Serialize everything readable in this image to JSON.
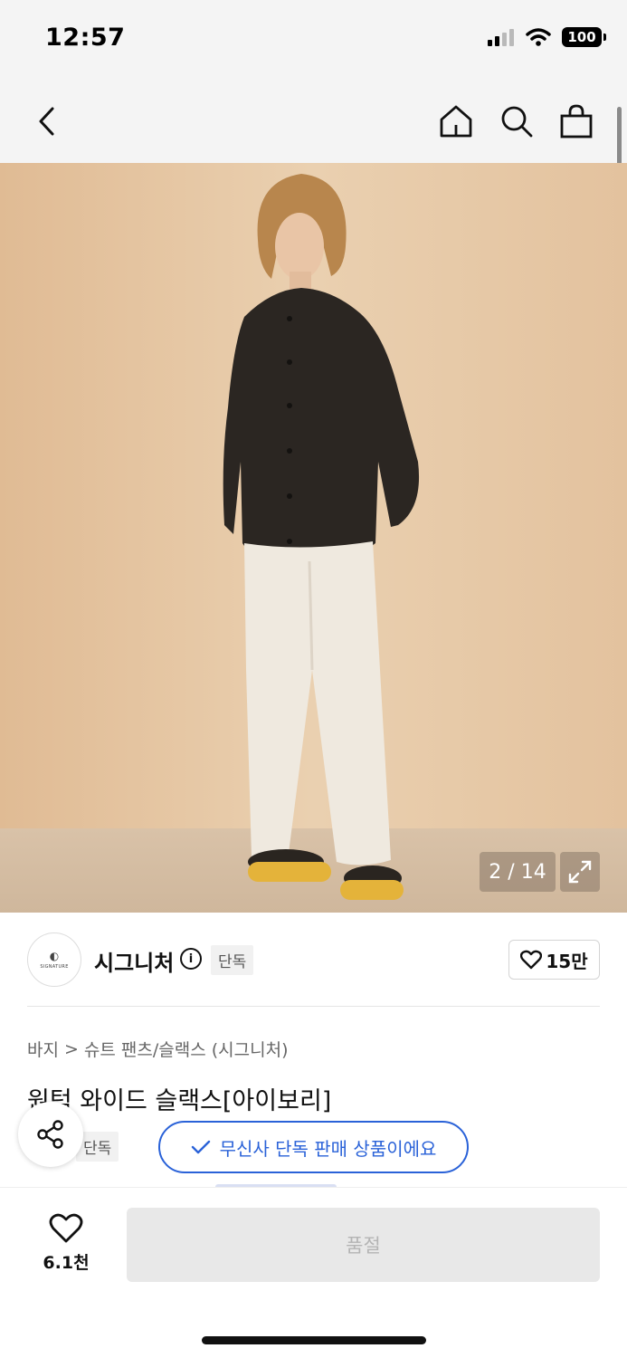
{
  "status_bar": {
    "time": "12:57",
    "battery": "100"
  },
  "nav": {
    "back_icon": "chevron-left-icon",
    "home_icon": "home-icon",
    "search_icon": "search-icon",
    "cart_icon": "shopping-bag-icon"
  },
  "gallery": {
    "counter": "2 / 14",
    "current": 2,
    "total": 14,
    "expand_icon": "expand-icon"
  },
  "brand": {
    "logo_text": "SIGNATURE",
    "name": "시그니처",
    "tag": "단독",
    "like_count": "15만"
  },
  "breadcrumb": {
    "category": "바지",
    "separator": ">",
    "subcategory": "슈트 팬츠/슬랙스 (시그니처)"
  },
  "product": {
    "title": "원턱 와이드 슬랙스[아이보리]",
    "tag": "단독"
  },
  "toast": {
    "text": "무신사 단독 판매 상품이에요"
  },
  "bottom": {
    "wish_count": "6.1천",
    "buy_label": "품절"
  },
  "colors": {
    "accent": "#2a62d8",
    "backdrop": "#e6c5a0",
    "bar_bg": "#f4f4f4"
  }
}
